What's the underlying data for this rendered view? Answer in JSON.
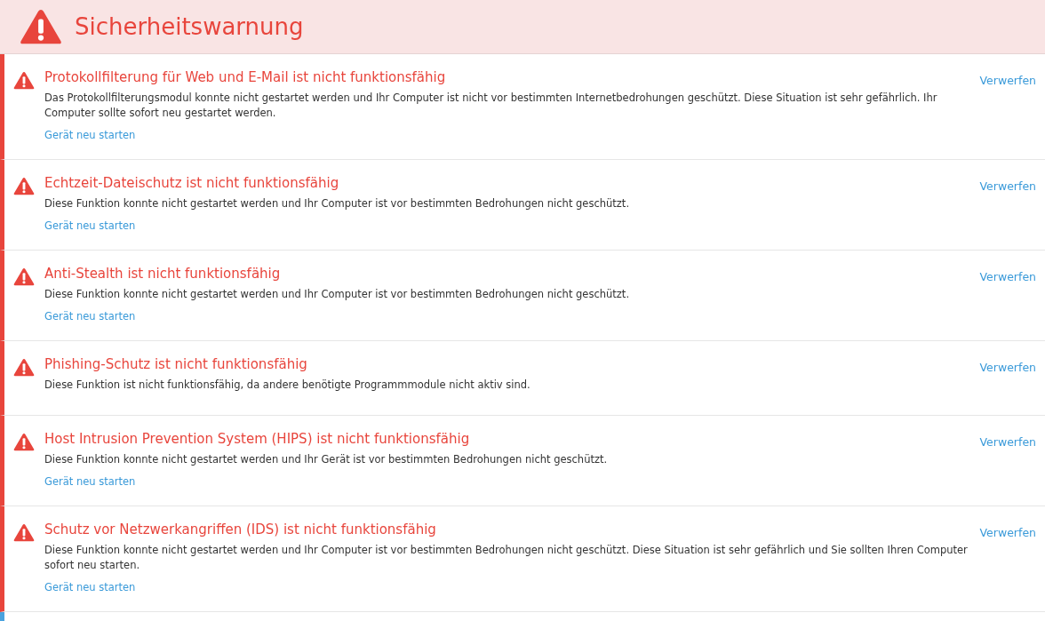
{
  "header": {
    "title": "Sicherheitswarnung"
  },
  "alerts": [
    {
      "color": "#e8453c",
      "title": "Protokollfilterung für Web und E-Mail ist nicht funktionsfähig",
      "description": "Das Protokollfilterungsmodul konnte nicht gestartet werden und Ihr Computer ist nicht vor bestimmten Internetbedrohungen geschützt. Diese Situation ist sehr gefährlich. Ihr Computer sollte sofort neu gestartet werden.",
      "action": "Gerät neu starten",
      "dismiss": "Verwerfen"
    },
    {
      "color": "#e8453c",
      "title": "Echtzeit-Dateischutz ist nicht funktionsfähig",
      "description": "Diese Funktion konnte nicht gestartet werden und Ihr Computer ist vor bestimmten Bedrohungen nicht geschützt.",
      "action": "Gerät neu starten",
      "dismiss": "Verwerfen"
    },
    {
      "color": "#e8453c",
      "title": "Anti-Stealth ist nicht funktionsfähig",
      "description": "Diese Funktion konnte nicht gestartet werden und Ihr Computer ist vor bestimmten Bedrohungen nicht geschützt.",
      "action": "Gerät neu starten",
      "dismiss": "Verwerfen"
    },
    {
      "color": "#e8453c",
      "title": "Phishing-Schutz ist nicht funktionsfähig",
      "description": "Diese Funktion ist nicht funktionsfähig, da andere benötigte Programmmodule nicht aktiv sind.",
      "dismiss": "Verwerfen"
    },
    {
      "color": "#e8453c",
      "title": "Host Intrusion Prevention System (HIPS) ist nicht funktionsfähig",
      "description": "Diese Funktion konnte nicht gestartet werden und Ihr Gerät ist vor bestimmten Bedrohungen nicht geschützt.",
      "action": "Gerät neu starten",
      "dismiss": "Verwerfen"
    },
    {
      "color": "#e8453c",
      "title": "Schutz vor Netzwerkangriffen (IDS) ist nicht funktionsfähig",
      "description": "Diese Funktion konnte nicht gestartet werden und Ihr Computer ist vor bestimmten Bedrohungen nicht geschützt. Diese Situation ist sehr gefährlich und Sie sollten Ihren Computer sofort neu starten.",
      "action": "Gerät neu starten",
      "dismiss": "Verwerfen"
    },
    {
      "color": "#4aa3df"
    }
  ]
}
